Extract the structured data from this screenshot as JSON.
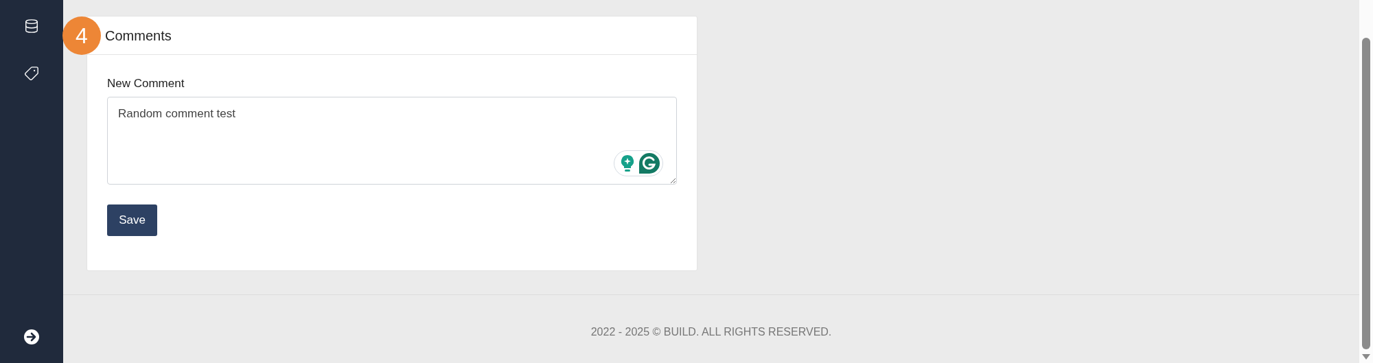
{
  "section": {
    "step": "4",
    "title": "Comments"
  },
  "comment_field": {
    "label": "New Comment",
    "value": "Random comment test"
  },
  "save_button": "Save",
  "footer": "2022 - 2025 © BUILD. ALL RIGHTS RESERVED."
}
